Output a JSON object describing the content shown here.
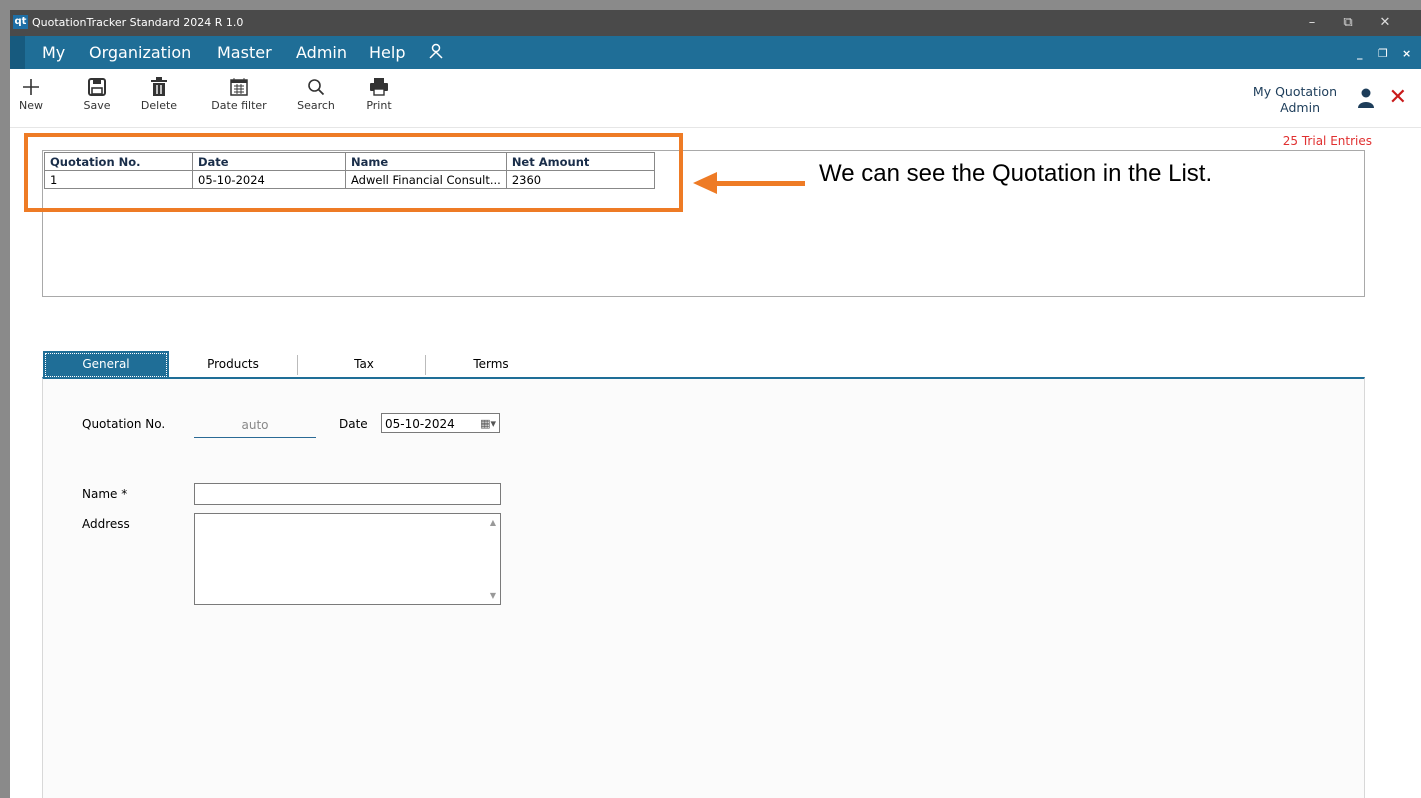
{
  "titlebar": {
    "logo": "qt",
    "title": "QuotationTracker Standard 2024 R 1.0",
    "minimize": "–",
    "restore": "⧉",
    "close": "✕"
  },
  "menu": {
    "items": [
      "My",
      "Organization",
      "Master",
      "Admin",
      "Help"
    ],
    "user_icon": "person-icon",
    "mdi_min": "_",
    "mdi_restore": "❐",
    "mdi_close": "×"
  },
  "toolbar": {
    "new_label": "New",
    "save_label": "Save",
    "delete_label": "Delete",
    "date_filter_label": "Date filter",
    "search_label": "Search",
    "print_label": "Print"
  },
  "user": {
    "line1": "My Quotation",
    "line2": "Admin"
  },
  "trial_text": "25 Trial Entries",
  "list": {
    "headers": [
      "Quotation No.",
      "Date",
      "Name",
      "Net Amount"
    ],
    "rows": [
      [
        "1",
        "05-10-2024",
        "Adwell Financial Consult...",
        "2360"
      ]
    ]
  },
  "annotation": "We can see the Quotation in the List.",
  "tabs": [
    "General",
    "Products",
    "Tax",
    "Terms"
  ],
  "form": {
    "quotation_no_label": "Quotation No.",
    "quotation_no_value": "auto",
    "date_label": "Date",
    "date_value": "05-10-2024",
    "name_label": "Name *",
    "address_label": "Address"
  },
  "colors": {
    "accent": "#1f6e97",
    "highlight": "#ee7b25",
    "trial": "#e03030",
    "close": "#c91a1a"
  }
}
